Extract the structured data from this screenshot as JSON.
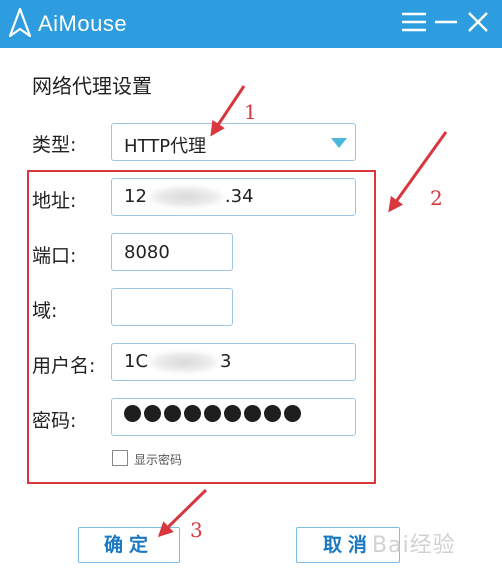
{
  "window": {
    "app_title": "AiMouse",
    "icons": {
      "logo": "aimouse-logo-icon",
      "menu": "menu-icon",
      "minimize": "minimize-icon",
      "close": "close-icon"
    }
  },
  "form": {
    "section_title": "网络代理设置",
    "type": {
      "label": "类型:",
      "value": "HTTP代理"
    },
    "address": {
      "label": "地址:",
      "prefix": "12",
      "suffix": ".34"
    },
    "port": {
      "label": "端口:",
      "value": "8080"
    },
    "domain": {
      "label": "域:",
      "value": ""
    },
    "username": {
      "label": "用户名:",
      "prefix": "1C",
      "suffix": "3"
    },
    "password": {
      "label": "密码:",
      "dot_count": 9
    },
    "show_password": {
      "label": "显示密码",
      "checked": false
    }
  },
  "buttons": {
    "ok": "确定",
    "cancel": "取消"
  },
  "annotations": {
    "n1": "1",
    "n2": "2",
    "n3": "3",
    "color": "#d9363e"
  },
  "watermark": "Bai经验",
  "colors": {
    "titlebar": "#2d9de0",
    "button_text": "#1a78c2",
    "field_border": "#9ec6e0"
  }
}
